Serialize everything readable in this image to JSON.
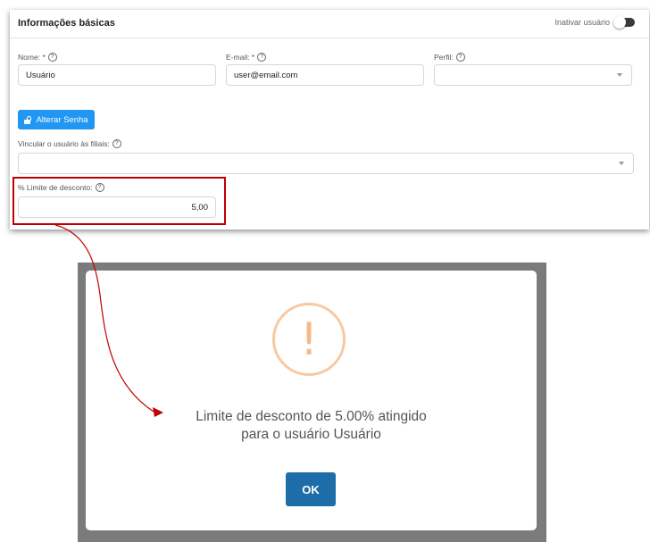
{
  "form": {
    "title": "Informações básicas",
    "toggle_label": "Inativar usuário",
    "name_label": "Nome: *",
    "name_value": "Usuário",
    "email_label": "E-mail: *",
    "email_value": "user@email.com",
    "profile_label": "Perfil:",
    "profile_value": "",
    "change_password_label": "Alterar Senha",
    "branches_label": "Vincular o usuário às filiais:",
    "branches_value": "",
    "discount_label": "% Limite de desconto:",
    "discount_value": "5,00",
    "help_glyph": "?"
  },
  "modal": {
    "icon_glyph": "!",
    "message_line1": "Limite de desconto de 5.00% atingido",
    "message_line2": "para o usuário Usuário",
    "ok_label": "OK"
  },
  "colors": {
    "primary": "#2196f3",
    "ok_button": "#1d6ea8",
    "highlight": "#c00000",
    "warning": "#f5b987"
  }
}
